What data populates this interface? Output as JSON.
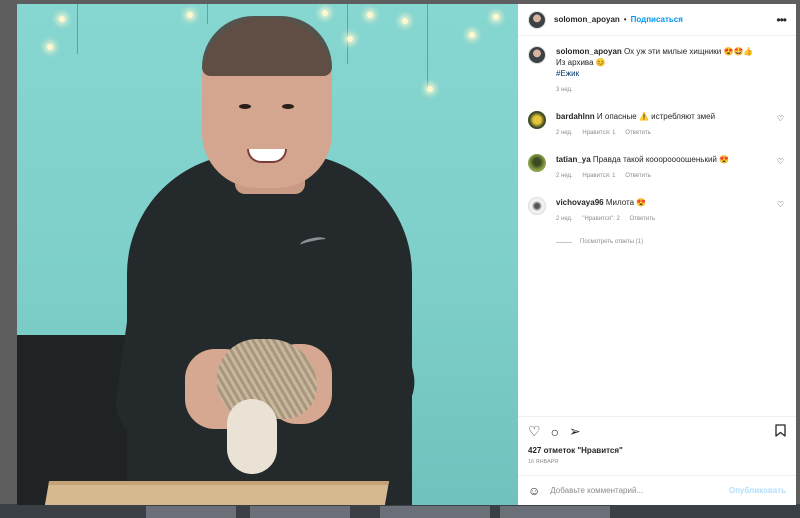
{
  "post": {
    "username": "solomon_apoyan",
    "dot": "•",
    "follow_label": "Подписаться",
    "more_icon": "more-horizontal-icon",
    "caption_text": "Ох уж эти милые хищники 😍🤩👍",
    "caption_line2": "Из архива 😊",
    "hashtag": "#Ежик",
    "time": "3 нед."
  },
  "comments": [
    {
      "user": "bardahlnn",
      "text": "И опасные ⚠️ истребляют змей",
      "time": "2 нед.",
      "likes": "Нравится: 1",
      "reply": "Ответить",
      "avatar_color": "#7a8b2e"
    },
    {
      "user": "tatian_ya",
      "text": "Правда такой кооороооошенький 😍",
      "time": "2 нед.",
      "likes": "Нравится: 1",
      "reply": "Ответить",
      "avatar_color": "#6d8a3a"
    },
    {
      "user": "vichovaya96",
      "text": "Милота 😍",
      "time": "2 нед.",
      "likes": "\"Нравится\": 2",
      "reply": "Ответить",
      "avatar_color": "#e8e8e8"
    }
  ],
  "view_replies": "Посмотреть ответы (1)",
  "stats": {
    "likes": "427 отметок \"Нравится\"",
    "date": "16 ЯНВАРЯ"
  },
  "add_comment": {
    "placeholder": "Добавьте комментарий...",
    "publish_label": "Опубликовать"
  },
  "colors": {
    "accent": "#0095f6",
    "publish_disabled": "#b2dffc",
    "photo_bg": "#86d6d1"
  }
}
